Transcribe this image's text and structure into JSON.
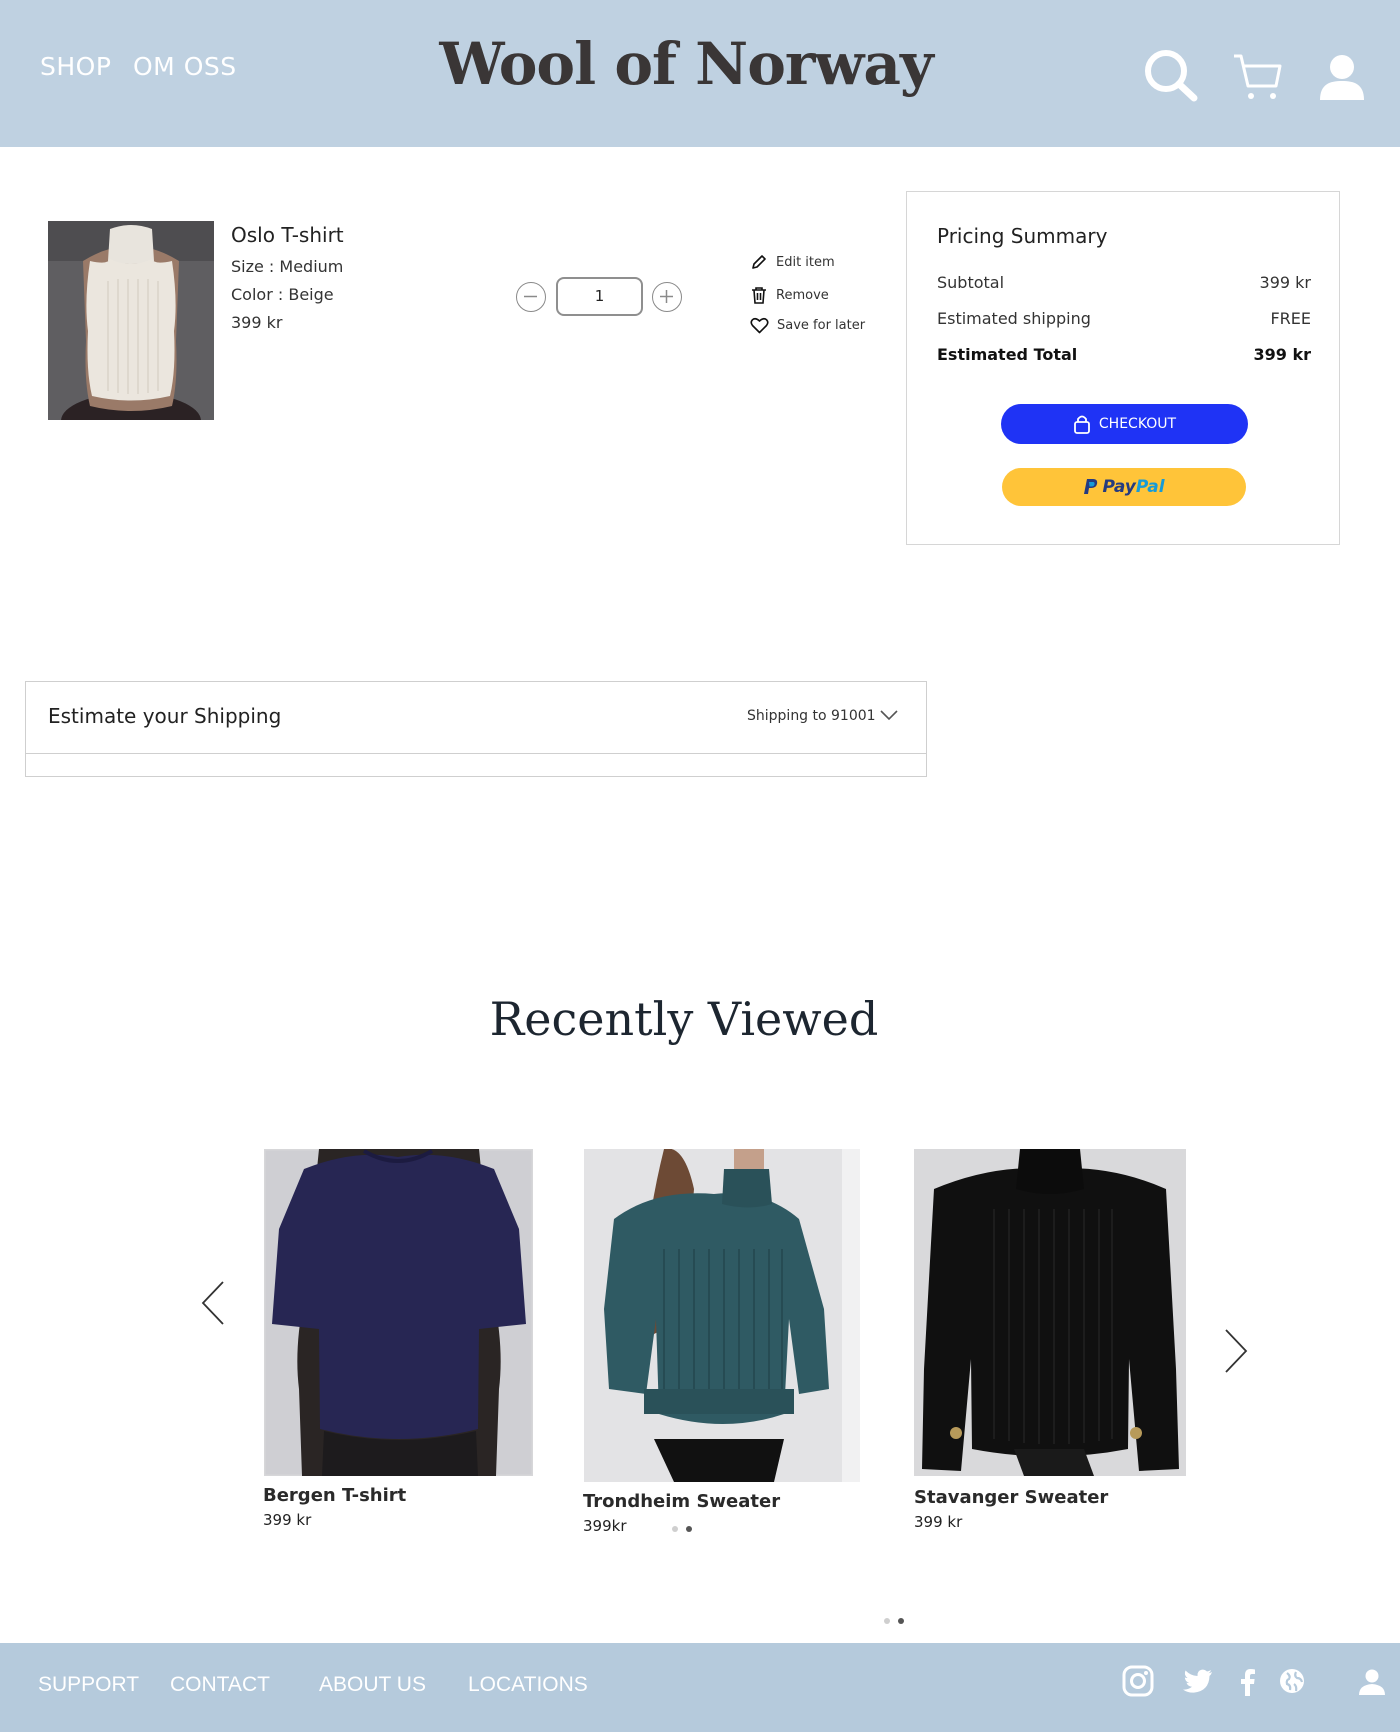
{
  "header": {
    "nav": [
      "SHOP",
      "OM OSS"
    ],
    "logo": "Wool of Norway",
    "icons": [
      "search-icon",
      "cart-icon",
      "user-icon"
    ]
  },
  "cart": {
    "item": {
      "name": "Oslo T-shirt",
      "size": "Size : Medium",
      "color": "Color : Beige",
      "price": "399 kr",
      "quantity": "1"
    },
    "actions": {
      "edit": "Edit item",
      "remove": "Remove",
      "save": "Save for later"
    }
  },
  "summary": {
    "title": "Pricing Summary",
    "subtotal_label": "Subtotal",
    "subtotal_value": "399 kr",
    "shipping_label": "Estimated shipping",
    "shipping_value": "FREE",
    "total_label": "Estimated Total",
    "total_value": "399 kr",
    "checkout_label": "CHECKOUT",
    "paypal_pay": "Pay",
    "paypal_pal": "Pal",
    "colors": {
      "checkout": "#1f33f5",
      "paypal": "#ffc439"
    }
  },
  "shipping": {
    "title": "Estimate your Shipping",
    "destination": "Shipping to 91001"
  },
  "recently_viewed": {
    "title": "Recently Viewed",
    "products": [
      {
        "name": "Bergen T-shirt",
        "price": "399 kr"
      },
      {
        "name": "Trondheim Sweater",
        "price": "399kr"
      },
      {
        "name": "Stavanger Sweater",
        "price": "399 kr"
      }
    ]
  },
  "footer": {
    "links": [
      "SUPPORT",
      "CONTACT",
      "ABOUT US",
      "LOCATIONS"
    ],
    "icons": [
      "instagram-icon",
      "twitter-icon",
      "facebook-icon",
      "globe-icon",
      "user-icon"
    ]
  }
}
